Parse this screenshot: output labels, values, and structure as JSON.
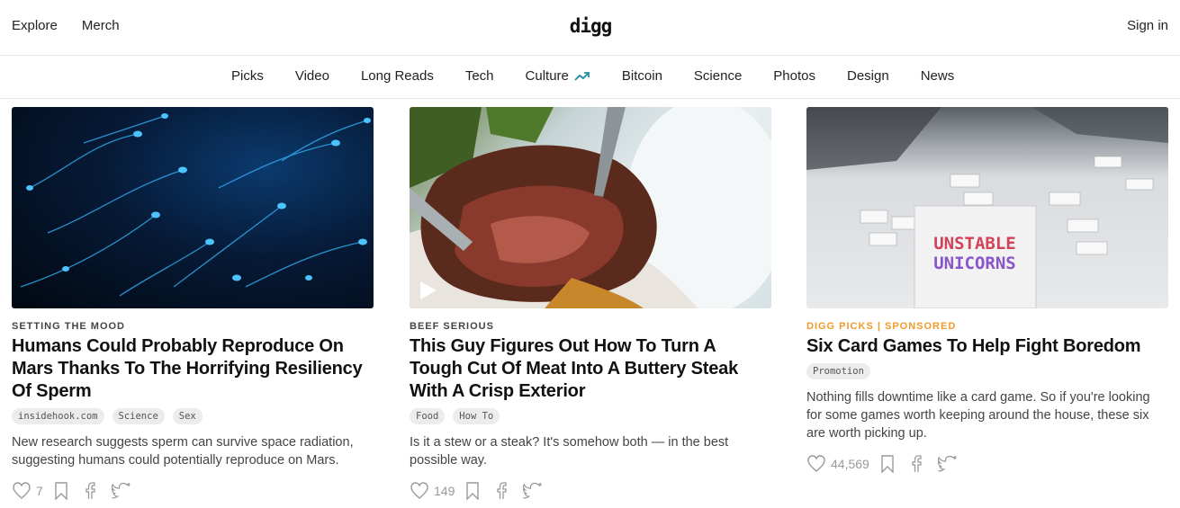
{
  "header": {
    "nav_left": [
      "Explore",
      "Merch"
    ],
    "logo_text": "digg",
    "sign_in": "Sign in"
  },
  "categories": [
    {
      "label": "Picks",
      "trending": false
    },
    {
      "label": "Video",
      "trending": false
    },
    {
      "label": "Long Reads",
      "trending": false
    },
    {
      "label": "Tech",
      "trending": false
    },
    {
      "label": "Culture",
      "trending": true
    },
    {
      "label": "Bitcoin",
      "trending": false
    },
    {
      "label": "Science",
      "trending": false
    },
    {
      "label": "Photos",
      "trending": false
    },
    {
      "label": "Design",
      "trending": false
    },
    {
      "label": "News",
      "trending": false
    }
  ],
  "colors": {
    "accent_teal": "#1b8ea6",
    "sponsored_orange": "#f09a2b"
  },
  "cards": [
    {
      "kicker": "SETTING THE MOOD",
      "headline": "Humans Could Probably Reproduce On Mars Thanks To The Horrifying Resiliency Of Sperm",
      "tags": [
        "insidehook.com",
        "Science",
        "Sex"
      ],
      "description": "New research suggests sperm can survive space radiation, suggesting humans could potentially reproduce on Mars.",
      "likes": "7",
      "image_icon": "sperm-photo"
    },
    {
      "kicker": "BEEF SERIOUS",
      "headline": "This Guy Figures Out How To Turn A Tough Cut Of Meat Into A Buttery Steak With A Crisp Exterior",
      "tags": [
        "Food",
        "How To"
      ],
      "description": "Is it a stew or a steak? It's somehow both — in the best possible way.",
      "likes": "149",
      "image_icon": "steak-video"
    },
    {
      "kicker": "DIGG PICKS | SPONSORED",
      "headline": "Six Card Games To Help Fight Boredom",
      "tags": [
        "Promotion"
      ],
      "description": "Nothing fills downtime like a card game. So if you're looking for some games worth keeping around the house, these six are worth picking up.",
      "likes": "44,569",
      "image_icon": "card-game-photo",
      "box_text_1": "UNSTABLE",
      "box_text_2": "UNICORNS"
    }
  ]
}
